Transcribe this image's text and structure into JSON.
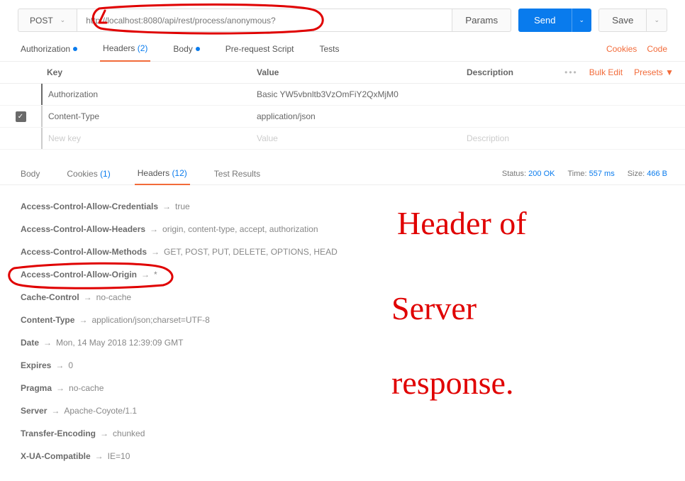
{
  "request": {
    "method": "POST",
    "url": "http://localhost:8080/api/rest/process/anonymous?",
    "params_label": "Params",
    "send_label": "Send",
    "save_label": "Save"
  },
  "req_tabs": {
    "auth": "Authorization",
    "headers": "Headers",
    "headers_count": "(2)",
    "body": "Body",
    "prs": "Pre-request Script",
    "tests": "Tests",
    "cookies_link": "Cookies",
    "code_link": "Code"
  },
  "kv_headers": {
    "key": "Key",
    "value": "Value",
    "description": "Description",
    "bulk": "Bulk Edit",
    "presets": "Presets ▼"
  },
  "kv_rows": [
    {
      "checked": false,
      "key": "Authorization",
      "value": "Basic YW5vbnltb3VzOmFiY2QxMjM0",
      "desc": ""
    },
    {
      "checked": true,
      "key": "Content-Type",
      "value": "application/json",
      "desc": ""
    }
  ],
  "kv_new": {
    "key": "New key",
    "value": "Value",
    "desc": "Description"
  },
  "resp_tabs": {
    "body": "Body",
    "cookies": "Cookies",
    "cookies_count": "(1)",
    "headers": "Headers",
    "headers_count": "(12)",
    "tests": "Test Results"
  },
  "resp_meta": {
    "status_label": "Status:",
    "status": "200 OK",
    "time_label": "Time:",
    "time": "557 ms",
    "size_label": "Size:",
    "size": "466 B"
  },
  "response_headers": [
    {
      "name": "Access-Control-Allow-Credentials",
      "value": "true"
    },
    {
      "name": "Access-Control-Allow-Headers",
      "value": "origin, content-type, accept, authorization"
    },
    {
      "name": "Access-Control-Allow-Methods",
      "value": "GET, POST, PUT, DELETE, OPTIONS, HEAD"
    },
    {
      "name": "Access-Control-Allow-Origin",
      "value": "*"
    },
    {
      "name": "Cache-Control",
      "value": "no-cache"
    },
    {
      "name": "Content-Type",
      "value": "application/json;charset=UTF-8"
    },
    {
      "name": "Date",
      "value": "Mon, 14 May 2018 12:39:09 GMT"
    },
    {
      "name": "Expires",
      "value": "0"
    },
    {
      "name": "Pragma",
      "value": "no-cache"
    },
    {
      "name": "Server",
      "value": "Apache-Coyote/1.1"
    },
    {
      "name": "Transfer-Encoding",
      "value": "chunked"
    },
    {
      "name": "X-UA-Compatible",
      "value": "IE=10"
    }
  ],
  "annotation": {
    "line1": "Header of",
    "line2": "Server",
    "line3": "response."
  }
}
